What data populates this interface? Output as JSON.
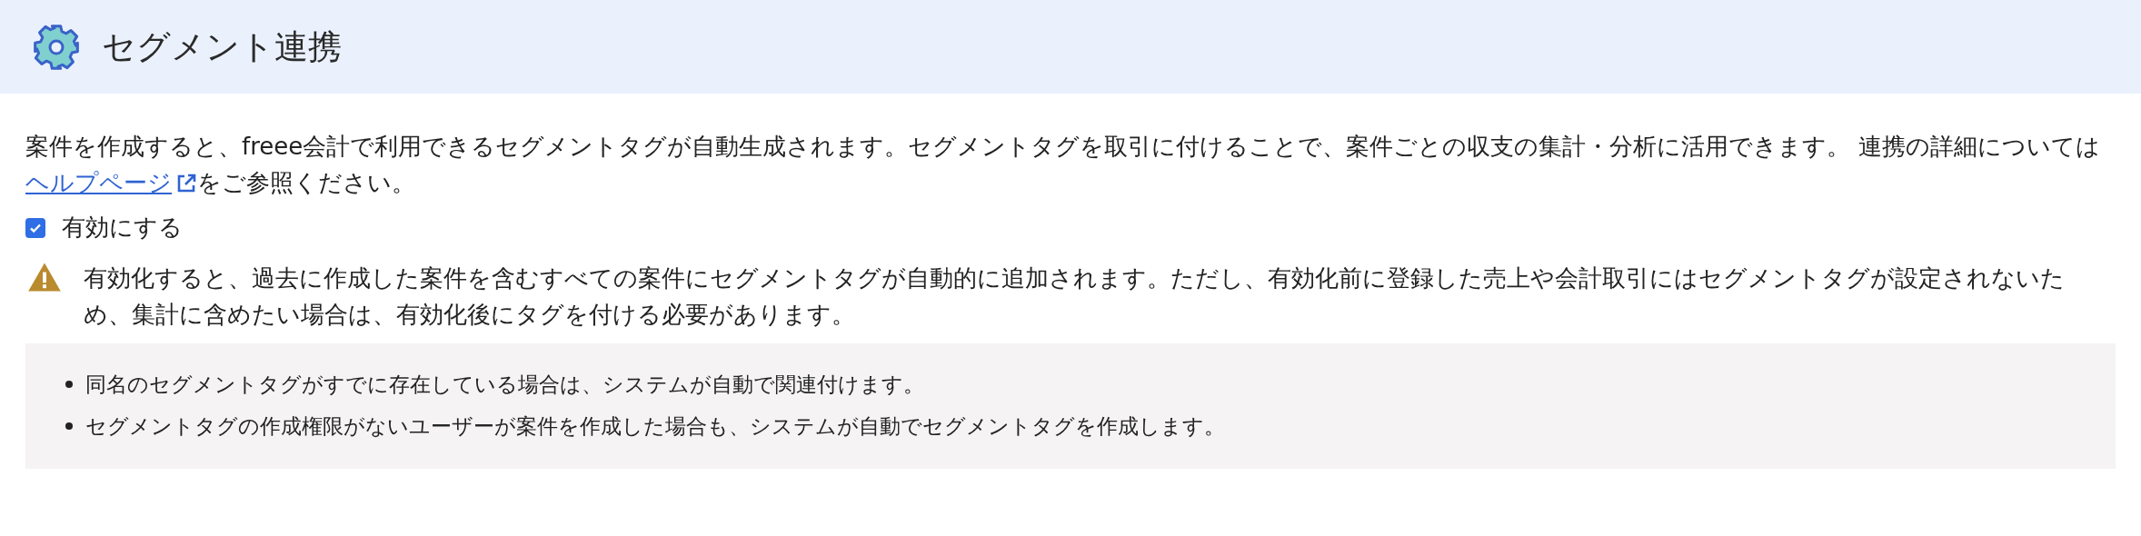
{
  "header": {
    "title": "セグメント連携"
  },
  "description": {
    "text_before": "案件を作成すると、freee会計で利用できるセグメントタグが自動生成されます。セグメントタグを取引に付けることで、案件ごとの収支の集計・分析に活用できます。 連携の詳細については",
    "link": "ヘルプページ",
    "text_after": "をご参照ください。"
  },
  "enable_checkbox": {
    "label": "有効にする",
    "checked": true
  },
  "warning": {
    "text": "有効化すると、過去に作成した案件を含むすべての案件にセグメントタグが自動的に追加されます。ただし、有効化前に登録した売上や会計取引にはセグメントタグが設定されないため、集計に含めたい場合は、有効化後にタグを付ける必要があります。"
  },
  "notes": [
    "同名のセグメントタグがすでに存在している場合は、システムが自動で関連付けます。",
    "セグメントタグの作成権限がないユーザーが案件を作成した場合も、システムが自動でセグメントタグを作成します。"
  ]
}
